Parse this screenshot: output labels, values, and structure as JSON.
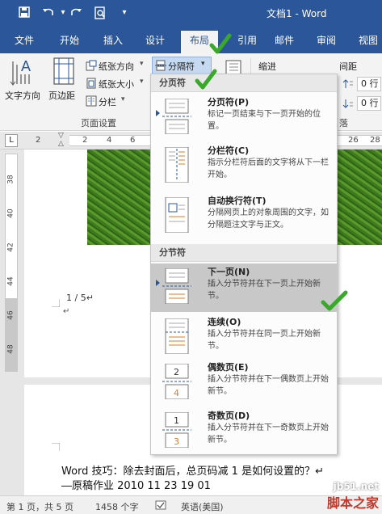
{
  "titlebar": {
    "title": "文档1 - Word",
    "icons": [
      "save-icon",
      "undo-icon",
      "redo-icon",
      "print-preview-icon",
      "customize-qat-icon"
    ],
    "window_controls": [
      "ribbon-display-icon",
      "minimize-icon"
    ]
  },
  "tabs": [
    "文件",
    "开始",
    "插入",
    "设计",
    "布局",
    "引用",
    "邮件",
    "审阅",
    "视图"
  ],
  "active_tab": "布局",
  "ribbon": {
    "text_direction": "文字方向",
    "margins": "页边距",
    "orientation": "纸张方向",
    "size": "纸张大小",
    "columns": "分栏",
    "breaks": "分隔符",
    "page_setup_group": "页面设置",
    "indent_label": "缩进",
    "spacing_label": "间距",
    "spacing_before": "0 行",
    "spacing_after": "0 行",
    "paragraph_group_tail": "落"
  },
  "ruler": {
    "numbers": [
      "2",
      "2",
      "4",
      "6",
      "26",
      "28"
    ],
    "corner": "L",
    "vertical_numbers": [
      "38",
      "40",
      "42",
      "44",
      "46",
      "48"
    ]
  },
  "breaks_menu": {
    "page_breaks_header": "分页符",
    "section_breaks_header": "分节符",
    "items": [
      {
        "title": "分页符(P)",
        "desc": "标记一页结束与下一页开始的位置。"
      },
      {
        "title": "分栏符(C)",
        "desc": "指示分栏符后面的文字将从下一栏开始。"
      },
      {
        "title": "自动换行符(T)",
        "desc": "分隔网页上的对象周围的文字，如分隔题注文字与正文。"
      },
      {
        "title": "下一页(N)",
        "desc": "插入分节符并在下一页上开始新节。"
      },
      {
        "title": "连续(O)",
        "desc": "插入分节符并在同一页上开始新节。"
      },
      {
        "title": "偶数页(E)",
        "desc": "插入分节符并在下一偶数页上开始新节。"
      },
      {
        "title": "奇数页(D)",
        "desc": "插入分节符并在下一奇数页上开始新节。"
      }
    ],
    "highlighted": "下一页(N)"
  },
  "document": {
    "footer_text": "1 / 5↵",
    "para_mark": "↵",
    "body_line1": "Word 技巧：除去封面后，总页码减 1 是如何设置的？↵",
    "body_line2": "―原稿作业 2010 11 23 19 01"
  },
  "statusbar": {
    "page": "第 1 页，共 5 页",
    "words": "1458 个字",
    "language": "英语(美国)"
  },
  "watermark": {
    "line1": "jb51.net",
    "line2": "脚本之家"
  },
  "colors": {
    "accent": "#2b579a",
    "check": "#3aa82b",
    "hover": "#c8c8c8"
  }
}
